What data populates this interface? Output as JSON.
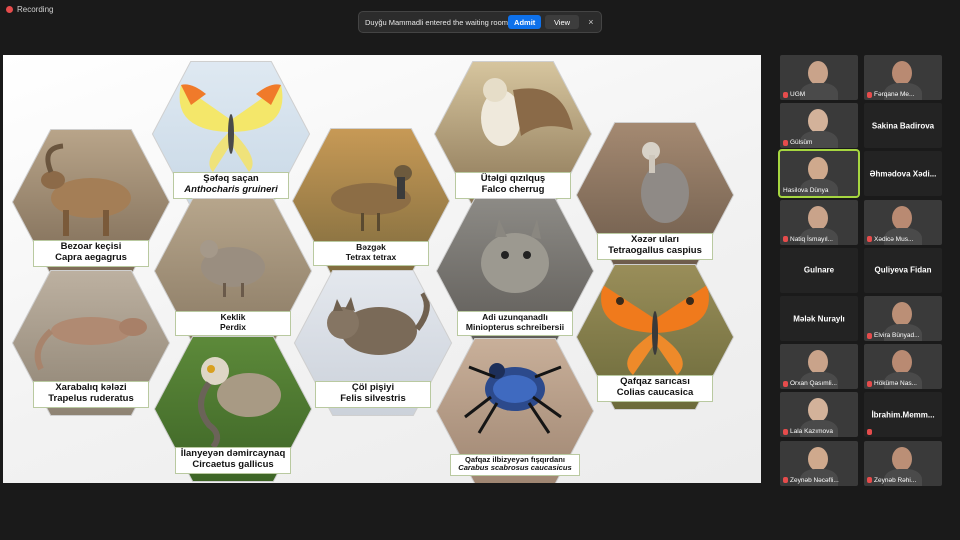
{
  "recording": {
    "label": "Recording"
  },
  "notification": {
    "message": "Duyğu Mammadli entered the waiting room",
    "admit_label": "Admit",
    "view_label": "View",
    "close_icon": "×"
  },
  "colors": {
    "accent": "#0e71eb",
    "active_speaker": "#a6d640",
    "mic_muted": "#e54c4c"
  },
  "slide": {
    "animals": [
      {
        "id": "bezoar",
        "name": "Bezoar keçisi",
        "latin": "Capra aegagrus",
        "italic": false
      },
      {
        "id": "anthocharis",
        "name": "Şəfəq saçan",
        "latin": "Anthocharis gruineri",
        "italic": true
      },
      {
        "id": "tetrax",
        "name": "Bəzgək",
        "latin": "Tetrax tetrax",
        "italic": false
      },
      {
        "id": "falco",
        "name": "Ütəlgi qızılquş",
        "latin": "Falco cherrug",
        "italic": false
      },
      {
        "id": "tetraogallus",
        "name": "Xəzər uları",
        "latin": "Tetraogallus caspius",
        "italic": false
      },
      {
        "id": "perdix",
        "name": "Keklik",
        "latin": "Perdix",
        "italic": false
      },
      {
        "id": "miniopterus",
        "name": "Adi uzunqanadlı",
        "latin": "Miniopterus schreibersii",
        "italic": false
      },
      {
        "id": "trapelus",
        "name": "Xarabalıq kələzi",
        "latin": "Trapelus ruderatus",
        "italic": false
      },
      {
        "id": "felis",
        "name": "Çöl pişiyi",
        "latin": "Felis silvestris",
        "italic": false
      },
      {
        "id": "colias",
        "name": "Qafqaz sarıcası",
        "latin": "Colias caucasica",
        "italic": false
      },
      {
        "id": "circaetus",
        "name": "İlanyeyən dəmircaynaq",
        "latin": "Circaetus gallicus",
        "italic": false
      },
      {
        "id": "carabus",
        "name": "Qafqaz ilbizyeyən fışqırdanı",
        "latin": "Carabus scabrosus caucasicus",
        "italic": true
      }
    ]
  },
  "participants": [
    {
      "name": "UGM",
      "camera": true,
      "muted": true
    },
    {
      "name": "Fərqanə Me...",
      "camera": true,
      "muted": true
    },
    {
      "name": "Gülsüm",
      "camera": true,
      "muted": true
    },
    {
      "name": "Sakina Badirova",
      "camera": false,
      "muted": false
    },
    {
      "name": "Hasilova Dünya",
      "camera": true,
      "muted": false,
      "active": true
    },
    {
      "name": "Əhmədova Xədi...",
      "camera": false,
      "muted": false
    },
    {
      "name": "Natiq İsmayıl...",
      "camera": true,
      "muted": true
    },
    {
      "name": "Xədicə Mus...",
      "camera": true,
      "muted": true
    },
    {
      "name": "Gulnare",
      "camera": false,
      "muted": false
    },
    {
      "name": "Quliyeva Fidan",
      "camera": false,
      "muted": false
    },
    {
      "name": "Mələk Nuraylı",
      "camera": false,
      "muted": false
    },
    {
      "name": "Elvira Bünyad...",
      "camera": true,
      "muted": true
    },
    {
      "name": "Orxan Qasımli...",
      "camera": true,
      "muted": true
    },
    {
      "name": "Hökümə Nas...",
      "camera": true,
      "muted": true
    },
    {
      "name": "Lala Kazımova",
      "camera": true,
      "muted": true
    },
    {
      "name": "İbrahim.Memm...",
      "camera": false,
      "muted": true
    },
    {
      "name": "Zeynəb Nəcəfli...",
      "camera": true,
      "muted": true
    },
    {
      "name": "Zeynəb Rəhi...",
      "camera": true,
      "muted": true
    }
  ]
}
